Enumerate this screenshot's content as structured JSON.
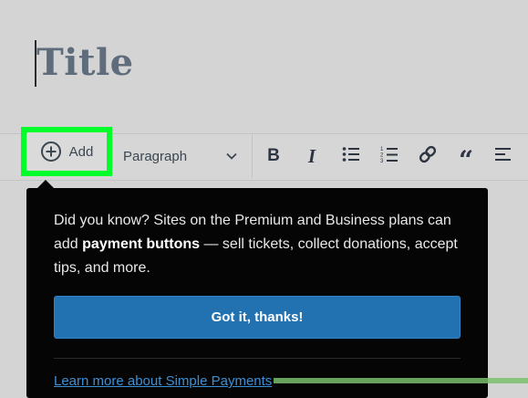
{
  "editor": {
    "title_placeholder": "Title"
  },
  "toolbar": {
    "add_label": "Add",
    "block_type": "Paragraph",
    "buttons": {
      "bold": "B",
      "italic": "I",
      "quote": "“"
    },
    "highlight_color": "#00ff2a"
  },
  "popover": {
    "text_before": "Did you know? Sites on the Premium and Business plans can add ",
    "text_bold": "payment buttons",
    "text_after": " — sell tickets, collect donations, accept tips, and more.",
    "confirm_label": "Got it, thanks!",
    "learn_more_label": "Learn more about Simple Payments",
    "background": "#050505",
    "button_color": "#2271b1"
  }
}
